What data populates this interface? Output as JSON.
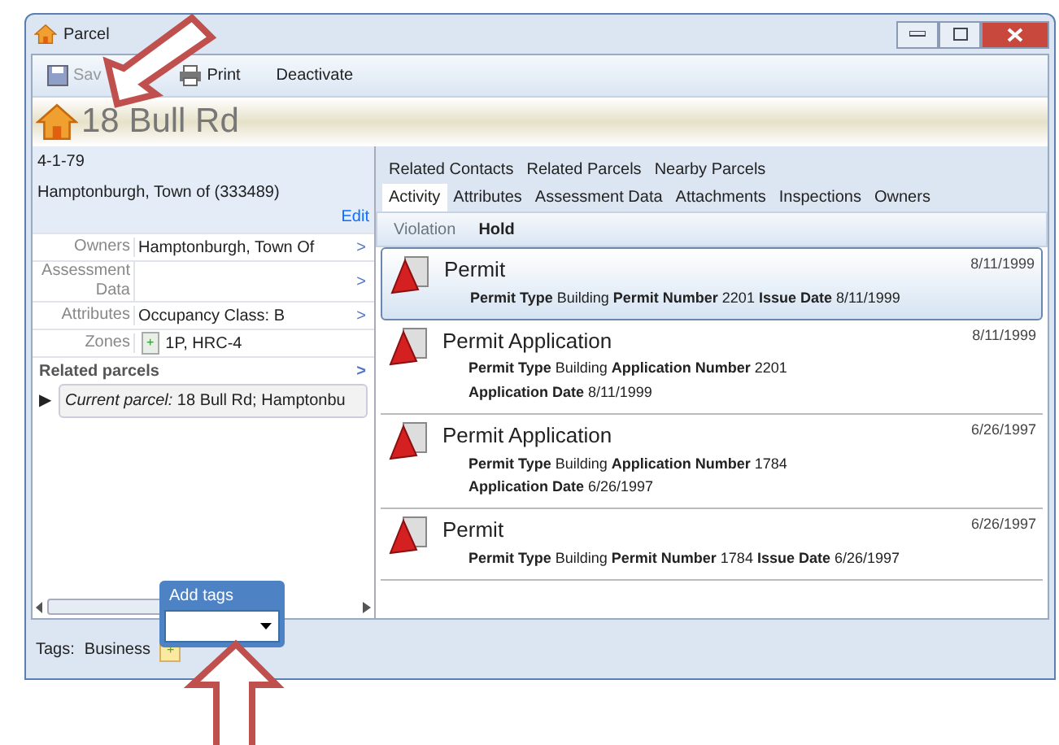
{
  "window": {
    "title": "Parcel"
  },
  "toolbar": [
    {
      "label": "Sav",
      "disabled": true
    },
    {
      "label": "Print",
      "disabled": false
    },
    {
      "label": "Deactivate",
      "disabled": false
    }
  ],
  "header": {
    "title": "18 Bull Rd"
  },
  "parcel": {
    "id": "4-1-79",
    "municipality": "Hamptonburgh, Town of (333489)",
    "edit": "Edit",
    "fields": [
      {
        "label": "Owners",
        "value": "Hamptonburgh, Town Of",
        "more": ">"
      },
      {
        "label": "Assessment Data",
        "more": ">"
      },
      {
        "label": "Attributes",
        "value": "Occupancy Class: B",
        "more": ">"
      },
      {
        "label": "Zones",
        "value": "1P, HRC-4",
        "add": "+"
      }
    ],
    "related": {
      "label": "Related parcels",
      "more": ">",
      "expander": "▶",
      "current_label": "Current parcel:",
      "current": "18 Bull Rd; Hamptonbu"
    }
  },
  "tab_rows": [
    [
      {
        "label": "Related Contacts",
        "selected": false
      },
      {
        "label": "Related Parcels",
        "selected": false
      },
      {
        "label": "Nearby Parcels",
        "selected": false
      }
    ],
    [
      {
        "label": "Activity",
        "selected": true
      },
      {
        "label": "Attributes",
        "selected": false
      },
      {
        "label": "Assessment Data",
        "selected": false
      },
      {
        "label": "Attachments",
        "selected": false
      },
      {
        "label": "Inspections",
        "selected": false
      },
      {
        "label": "Owners",
        "selected": false
      }
    ]
  ],
  "activity_toolbar": [
    {
      "label": "Violation",
      "disabled": true
    },
    {
      "label": "Hold",
      "disabled": false
    }
  ],
  "activities": [
    {
      "title": "Permit",
      "date": "8/11/1999",
      "selected": true,
      "lines": [
        "**Permit Type** Building **Permit Number** 2201 **Issue Date** 8/11/1999"
      ]
    },
    {
      "title": "Permit Application",
      "date": "8/11/1999",
      "selected": false,
      "lines": [
        "**Permit Type** Building **Application Number** 2201",
        "**Application Date** 8/11/1999"
      ]
    },
    {
      "title": "Permit Application",
      "date": "6/26/1997",
      "selected": false,
      "lines": [
        "**Permit Type** Building **Application Number** 1784",
        "**Application Date** 6/26/1997"
      ]
    },
    {
      "title": "Permit",
      "date": "6/26/1997",
      "selected": false,
      "lines": [
        "**Permit Type** Building **Permit Number** 1784 **Issue Date** 6/26/1997"
      ]
    }
  ],
  "tags": {
    "label": "Tags:",
    "items": [
      "Business"
    ],
    "add": "+",
    "popup": {
      "title": "Add tags"
    }
  }
}
